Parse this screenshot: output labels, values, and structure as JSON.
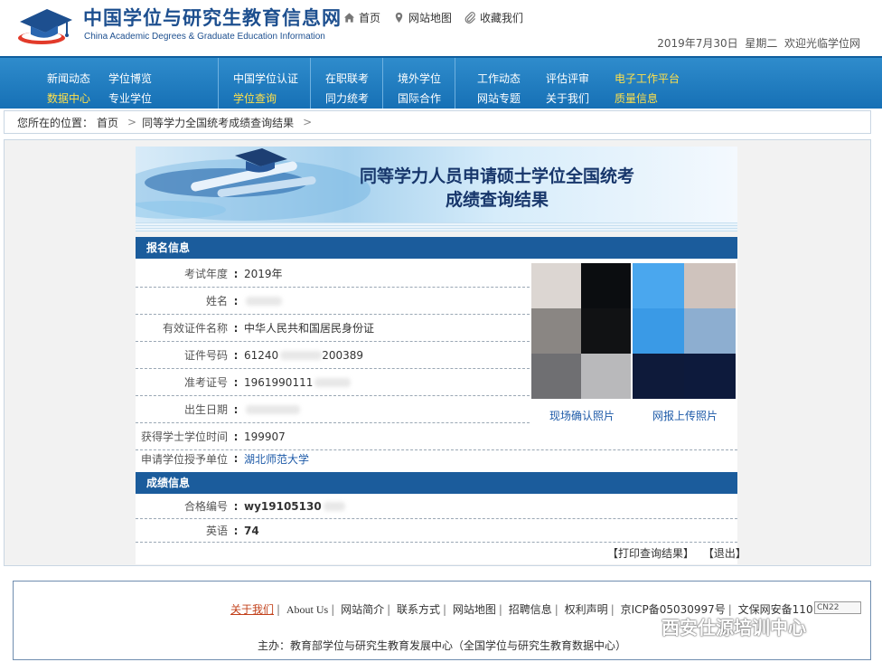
{
  "header": {
    "site_title_cn": "中国学位与研究生教育信息网",
    "site_title_en": "China Academic Degrees & Graduate Education Information",
    "links": [
      {
        "label": "首页",
        "icon": "home-icon"
      },
      {
        "label": "网站地图",
        "icon": "location-pin-icon"
      },
      {
        "label": "收藏我们",
        "icon": "paperclip-icon"
      }
    ],
    "date": "2019年7月30日",
    "weekday": "星期二",
    "welcome": "欢迎光临学位网"
  },
  "nav": {
    "groups": [
      [
        {
          "label": "新闻动态",
          "hl": false
        },
        {
          "label": "学位博览",
          "hl": false
        },
        {
          "label": "数据中心",
          "hl": true
        },
        {
          "label": "专业学位",
          "hl": false
        }
      ],
      [
        {
          "label": "中国学位认证",
          "hl": false
        },
        {
          "label": "学位查询",
          "hl": true
        }
      ],
      [
        {
          "label": "在职联考",
          "hl": false
        },
        {
          "label": "同力统考",
          "hl": false
        }
      ],
      [
        {
          "label": "境外学位",
          "hl": false
        },
        {
          "label": "国际合作",
          "hl": false
        }
      ],
      [
        {
          "label": "工作动态",
          "hl": false
        },
        {
          "label": "评估评审",
          "hl": false
        },
        {
          "label": "电子工作平台",
          "hl": true
        },
        {
          "label": "网站专题",
          "hl": false
        },
        {
          "label": "关于我们",
          "hl": false
        },
        {
          "label": "质量信息",
          "hl": true
        }
      ]
    ]
  },
  "breadcrumb": {
    "prefix": "您所在的位置：",
    "home": "首页",
    "current": "同等学力全国统考成绩查询结果",
    "sep": ">"
  },
  "banner": {
    "line1": "同等学力人员申请硕士学位全国统考",
    "line2": "成绩查询结果"
  },
  "registration": {
    "heading": "报名信息",
    "rows": [
      {
        "label": "考试年度",
        "value": "2019年"
      },
      {
        "label": "姓名",
        "value": ""
      },
      {
        "label": "有效证件名称",
        "value": "中华人民共和国居民身份证"
      },
      {
        "label": "证件号码",
        "value": "61240",
        "value_tail": "200389"
      },
      {
        "label": "准考证号",
        "value": "1961990111"
      },
      {
        "label": "出生日期",
        "value": ""
      },
      {
        "label": "获得学士学位时间",
        "value": "199907"
      },
      {
        "label": "申请学位授予单位",
        "value": "湖北师范大学"
      }
    ],
    "photo_captions": [
      "现场确认照片",
      "网报上传照片"
    ]
  },
  "scores": {
    "heading": "成绩信息",
    "rows": [
      {
        "label": "合格编号",
        "value": "wy19105130"
      },
      {
        "label": "英语",
        "value": "74"
      }
    ]
  },
  "actions": {
    "print": "【打印查询结果】",
    "exit": "【退出】"
  },
  "footer": {
    "links": [
      "关于我们",
      "About Us",
      "网站简介",
      "联系方式",
      "网站地图",
      "招聘信息",
      "权利声明",
      "京ICP备05030997号",
      "文保网安备110180049"
    ],
    "badge": "CN22",
    "sponsor": "主办：教育部学位与研究生教育发展中心（全国学位与研究生教育数据中心）"
  },
  "watermark": "西安仕源培训中心",
  "colors": {
    "nav_bg": "#1670b5",
    "nav_highlight": "#ffe04a",
    "section_head": "#1b5c9c",
    "link": "#1d5aa8"
  }
}
